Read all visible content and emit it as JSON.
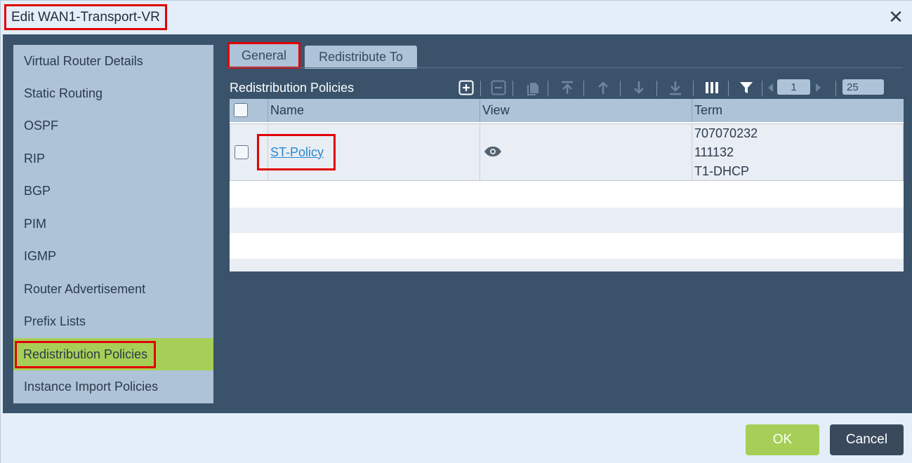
{
  "dialog": {
    "title": "Edit WAN1-Transport-VR",
    "close_glyph": "✕"
  },
  "sidebar": {
    "items": [
      {
        "label": "Virtual Router Details"
      },
      {
        "label": "Static Routing"
      },
      {
        "label": "OSPF"
      },
      {
        "label": "RIP"
      },
      {
        "label": "BGP"
      },
      {
        "label": "PIM"
      },
      {
        "label": "IGMP"
      },
      {
        "label": "Router Advertisement"
      },
      {
        "label": "Prefix Lists"
      },
      {
        "label": "Redistribution Policies",
        "active": true
      },
      {
        "label": "Instance Import Policies"
      }
    ]
  },
  "tabs": {
    "general": "General",
    "redistribute_to": "Redistribute To"
  },
  "section": {
    "title": "Redistribution Policies"
  },
  "toolbar": {
    "icons": [
      "add-icon",
      "remove-icon",
      "clone-icon",
      "move-top-icon",
      "move-up-icon",
      "move-down-icon",
      "move-bottom-icon",
      "columns-icon",
      "filter-icon",
      "prev-page-icon",
      "next-page-icon"
    ],
    "page": "1",
    "page_size": "25"
  },
  "table": {
    "columns": [
      "Name",
      "View",
      "Term"
    ],
    "rows": [
      {
        "name": "ST-Policy",
        "view_icon": "eye-icon",
        "terms": [
          "707070232",
          "111132",
          "T1-DHCP"
        ]
      }
    ]
  },
  "footer": {
    "ok_label": "OK",
    "cancel_label": "Cancel"
  },
  "colors": {
    "accent_green": "#a7cf57",
    "panel_dark": "#3a536b",
    "highlight_red": "#e00000",
    "link_blue": "#2a88d0"
  }
}
